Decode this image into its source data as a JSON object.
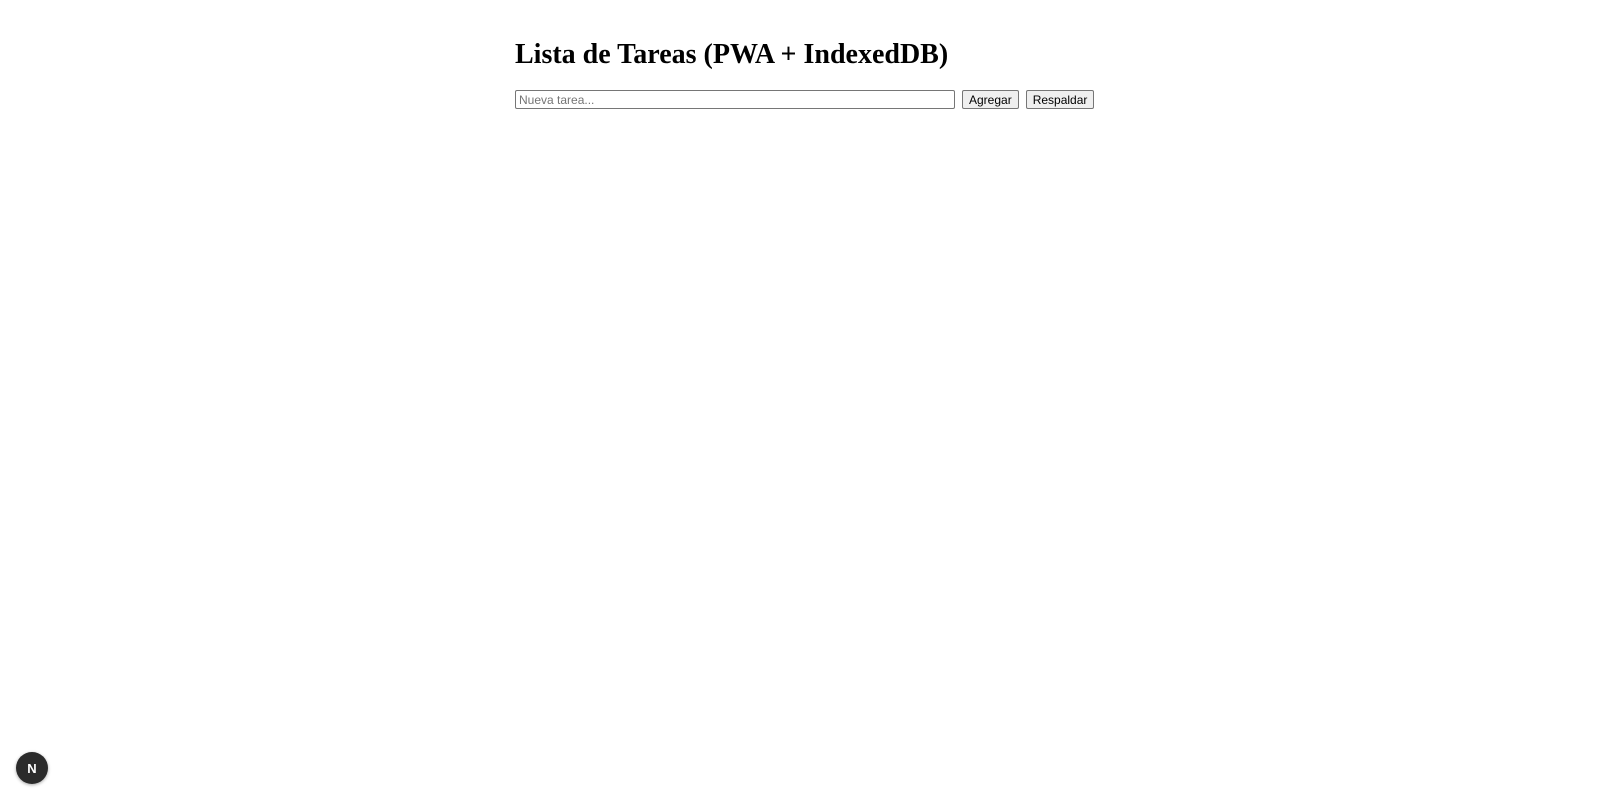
{
  "page": {
    "title": "Lista de Tareas (PWA + IndexedDB)"
  },
  "form": {
    "input_placeholder": "Nueva tarea...",
    "input_value": "",
    "add_label": "Agregar",
    "backup_label": "Respaldar"
  },
  "dev_indicator": {
    "icon": "nextjs-logo-icon",
    "glyph": "N"
  },
  "colors": {
    "background": "#ffffff",
    "badge": "#2b2b2b"
  }
}
